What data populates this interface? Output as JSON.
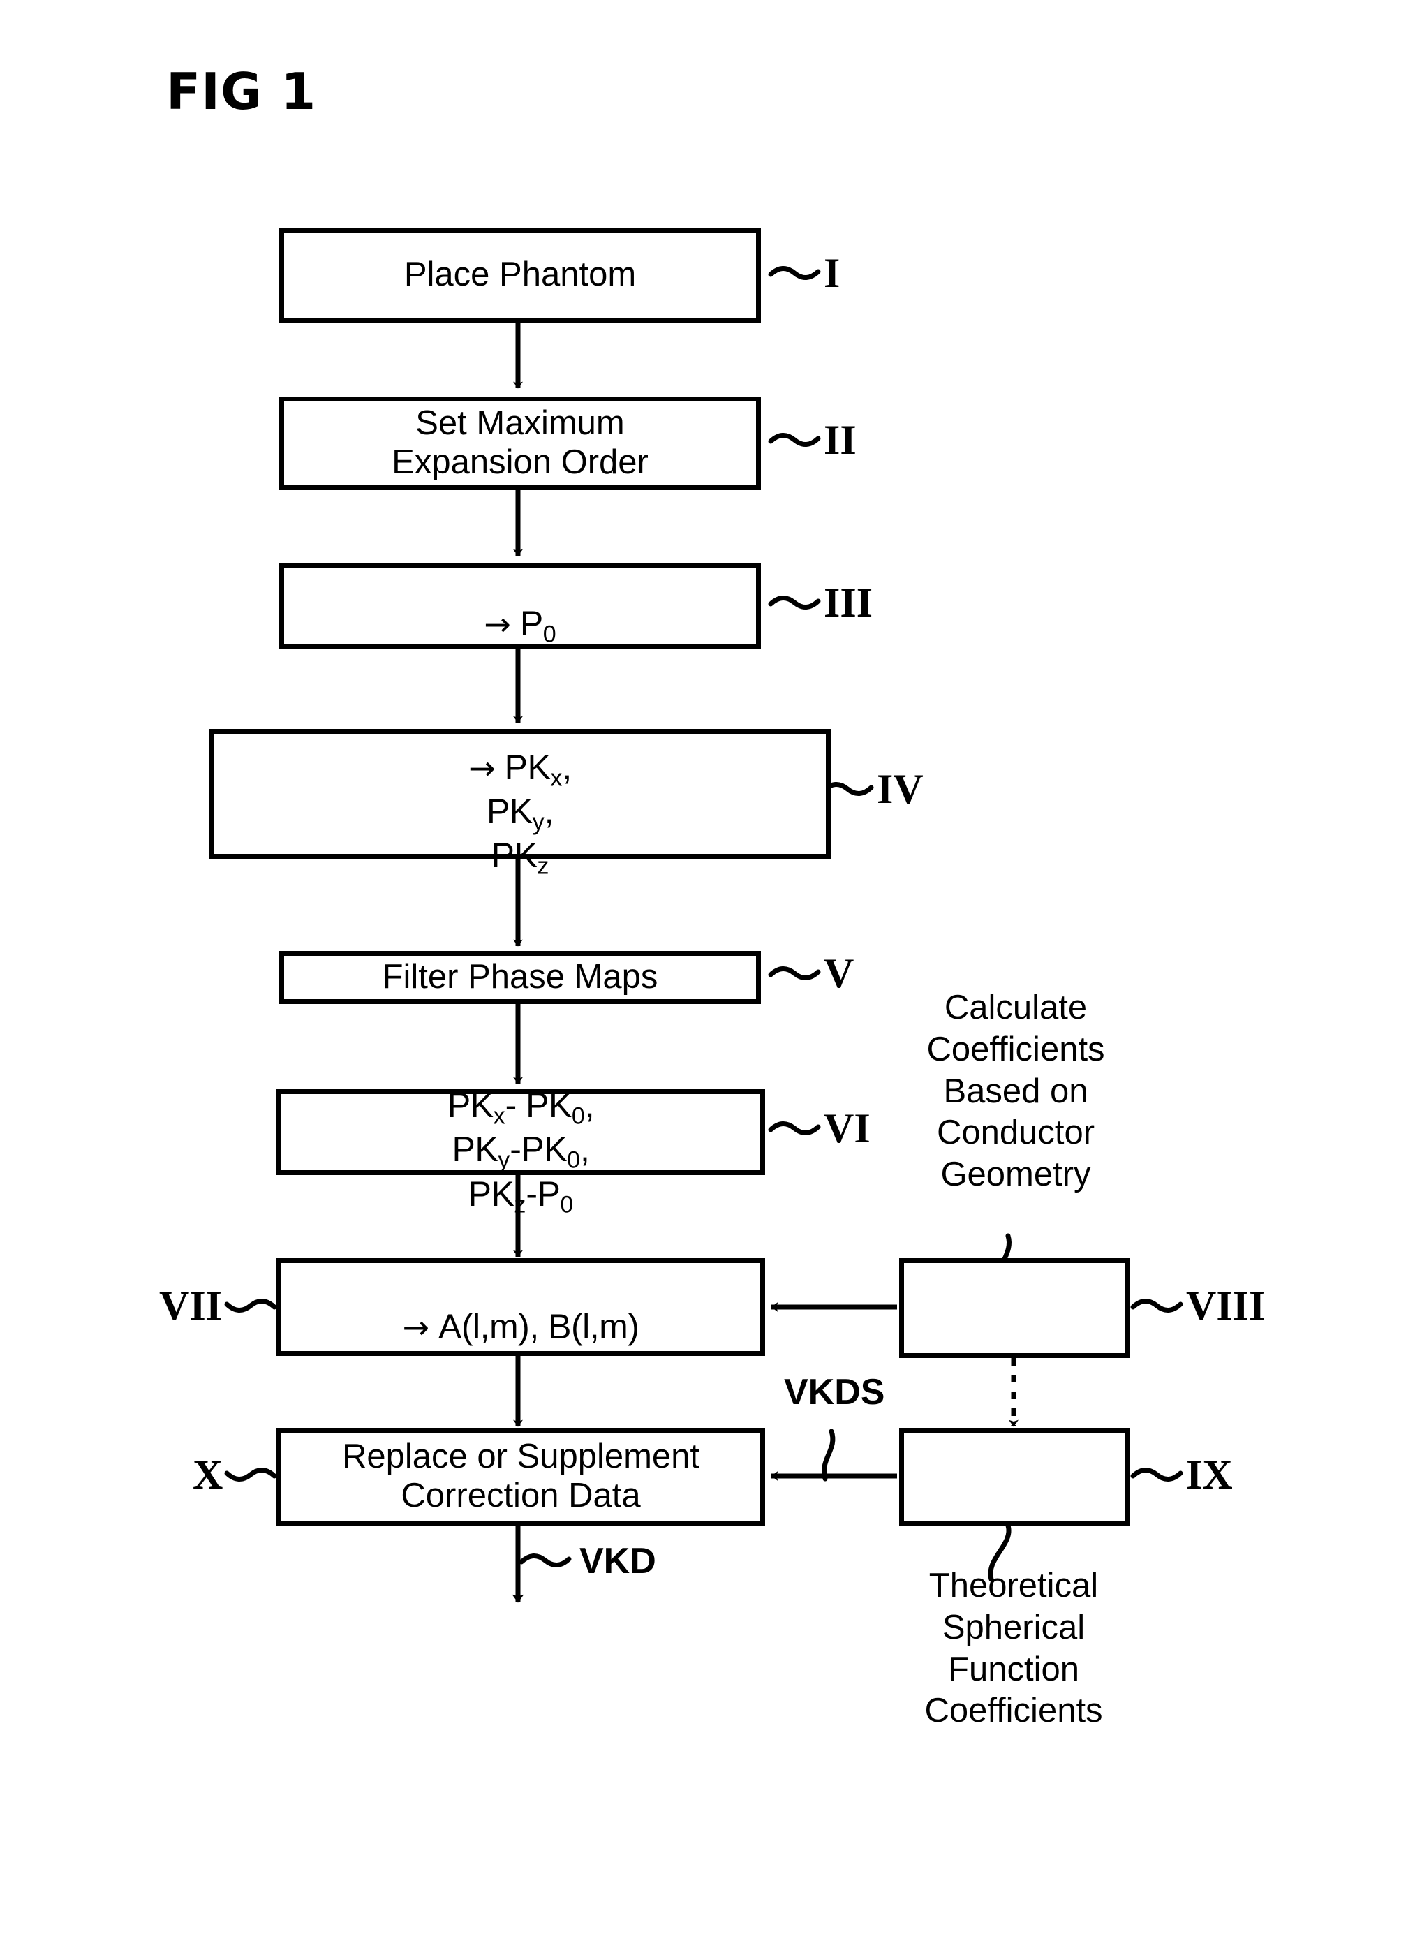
{
  "figure": {
    "title": "FIG 1"
  },
  "boxes": [
    {
      "id": "I",
      "label": "I",
      "text": "Place Phantom",
      "label_side": "right"
    },
    {
      "id": "II",
      "label": "II",
      "text": "Set Maximum\nExpansion Order",
      "label_side": "right"
    },
    {
      "id": "III",
      "label": "III",
      "text": "→ P0",
      "label_side": "right"
    },
    {
      "id": "IV",
      "label": "IV",
      "text": "→ PKx, PKy, PKz",
      "label_side": "right"
    },
    {
      "id": "V",
      "label": "V",
      "text": "Filter Phase Maps",
      "label_side": "right"
    },
    {
      "id": "VI",
      "label": "VI",
      "text": "PKx- PK0, PKy-PK0, PKz-P0",
      "label_side": "right"
    },
    {
      "id": "VII",
      "label": "VII",
      "text": "→ A(l,m), B(l,m)",
      "label_side": "left"
    },
    {
      "id": "VIII",
      "label": "VIII",
      "text": "",
      "label_side": "right"
    },
    {
      "id": "IX",
      "label": "IX",
      "text": "",
      "label_side": "right"
    },
    {
      "id": "X",
      "label": "X",
      "text": "Replace or Supplement\nCorrection Data",
      "label_side": "left"
    }
  ],
  "box_text": {
    "I": "Place Phantom",
    "II": "Set Maximum\nExpansion Order",
    "V": "Filter Phase Maps",
    "X": "Replace or Supplement\nCorrection Data"
  },
  "formulas": {
    "III": {
      "arrow": "→",
      "base": "P",
      "sub": "0"
    },
    "IV": {
      "arrow": "→",
      "terms": [
        {
          "base": "PK",
          "sub": "x"
        },
        {
          "base": "PK",
          "sub": "y"
        },
        {
          "base": "PK",
          "sub": "z"
        }
      ]
    },
    "VI": {
      "terms": [
        {
          "left_base": "PK",
          "left_sub": "x",
          "op": "- ",
          "right_base": "PK",
          "right_sub": "0"
        },
        {
          "left_base": "PK",
          "left_sub": "y",
          "op": "-",
          "right_base": "PK",
          "right_sub": "0"
        },
        {
          "left_base": "PK",
          "left_sub": "z",
          "op": "-",
          "right_base": "P",
          "right_sub": "0"
        }
      ]
    },
    "VII": {
      "arrow": "→",
      "text": "A(l,m), B(l,m)"
    }
  },
  "ref_labels": {
    "I": "I",
    "II": "II",
    "III": "III",
    "IV": "IV",
    "V": "V",
    "VI": "VI",
    "VII": "VII",
    "VIII": "VIII",
    "IX": "IX",
    "X": "X"
  },
  "annotations": {
    "conductor_geometry": "Calculate\nCoefficients\nBased on\nConductor\nGeometry",
    "spherical_coefficients": "Theoretical\nSpherical\nFunction\nCoefficients"
  },
  "signal_tags": {
    "vkds": "VKDS",
    "vkd": "VKD"
  },
  "colors": {
    "stroke": "#000000",
    "background": "#ffffff"
  }
}
